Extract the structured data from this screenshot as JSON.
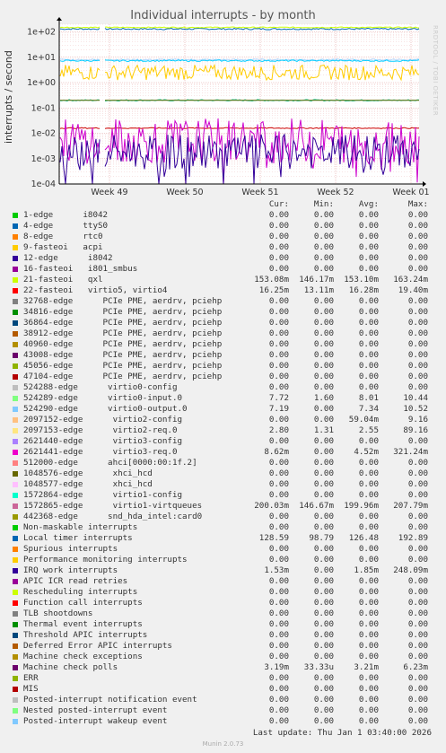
{
  "title": "Individual interrupts - by month",
  "side_credit": "RRDTOOL / TOBI OETIKER",
  "footer": {
    "last_update": "Last update: Thu Jan  1 03:40:00 2026",
    "version": "Munin 2.0.73"
  },
  "columns": [
    "Cur:",
    "Min:",
    "Avg:",
    "Max:"
  ],
  "chart_data": {
    "type": "line",
    "title": "Individual interrupts - by month",
    "ylabel": "interrupts / second",
    "yscale": "log",
    "ylim": [
      0.0001,
      200
    ],
    "y_ticks": [
      "1e-04",
      "1e-03",
      "1e-02",
      "1e-01",
      "1e+00",
      "1e+01",
      "1e+02"
    ],
    "x_ticks": [
      "Week 49",
      "Week 50",
      "Week 51",
      "Week 52",
      "Week 01"
    ],
    "grid": true,
    "series_traces": [
      {
        "name": "Local timer interrupts",
        "color": "#0066b3",
        "level": 130,
        "noise": 0.03
      },
      {
        "name": "1572865-edge",
        "color": "#00cc99",
        "level": 0.2,
        "noise": 0.03
      },
      {
        "name": "21-fasteoi",
        "color": "#ccff00",
        "level": 150,
        "noise": 0.02
      },
      {
        "name": "524289-edge",
        "color": "#b3d9ff",
        "level": 8,
        "noise": 0.03
      },
      {
        "name": "524290-edge",
        "color": "#00ccff",
        "level": 7.3,
        "noise": 0.03
      },
      {
        "name": "2097153-edge",
        "color": "#ffcc00",
        "level": 2.5,
        "noise": 0.3
      },
      {
        "name": "22-fasteoi",
        "color": "#cc0000",
        "level": 0.016,
        "noise": 0.02
      },
      {
        "name": "2621441-edge",
        "color": "#cc00cc",
        "level": 0.005,
        "noise": 0.9
      },
      {
        "name": "IRQ work interrupts",
        "color": "#330099",
        "level": 0.0018,
        "noise": 0.7
      },
      {
        "name": "Machine check polls",
        "color": "#666600",
        "level": 0.2,
        "noise": 0.0
      }
    ]
  },
  "legend": [
    {
      "color": "#00cc00",
      "name": "1-edge      i8042",
      "cur": "0.00",
      "min": "0.00",
      "avg": "0.00",
      "max": "0.00"
    },
    {
      "color": "#0066b3",
      "name": "4-edge      ttyS0",
      "cur": "0.00",
      "min": "0.00",
      "avg": "0.00",
      "max": "0.00"
    },
    {
      "color": "#ff8000",
      "name": "8-edge      rtc0",
      "cur": "0.00",
      "min": "0.00",
      "avg": "0.00",
      "max": "0.00"
    },
    {
      "color": "#ffcc00",
      "name": "9-fasteoi   acpi",
      "cur": "0.00",
      "min": "0.00",
      "avg": "0.00",
      "max": "0.00"
    },
    {
      "color": "#330099",
      "name": "12-edge      i8042",
      "cur": "0.00",
      "min": "0.00",
      "avg": "0.00",
      "max": "0.00"
    },
    {
      "color": "#990099",
      "name": "16-fasteoi   i801_smbus",
      "cur": "0.00",
      "min": "0.00",
      "avg": "0.00",
      "max": "0.00"
    },
    {
      "color": "#ccff00",
      "name": "21-fasteoi   qxl",
      "cur": "153.08m",
      "min": "146.17m",
      "avg": "153.10m",
      "max": "163.24m"
    },
    {
      "color": "#ff0000",
      "name": "22-fasteoi   virtio5, virtio4",
      "cur": "16.25m",
      "min": "13.11m",
      "avg": "16.28m",
      "max": "19.40m"
    },
    {
      "color": "#808080",
      "name": "32768-edge      PCIe PME, aerdrv, pciehp",
      "cur": "0.00",
      "min": "0.00",
      "avg": "0.00",
      "max": "0.00"
    },
    {
      "color": "#008f00",
      "name": "34816-edge      PCIe PME, aerdrv, pciehp",
      "cur": "0.00",
      "min": "0.00",
      "avg": "0.00",
      "max": "0.00"
    },
    {
      "color": "#00487d",
      "name": "36864-edge      PCIe PME, aerdrv, pciehp",
      "cur": "0.00",
      "min": "0.00",
      "avg": "0.00",
      "max": "0.00"
    },
    {
      "color": "#b35a00",
      "name": "38912-edge      PCIe PME, aerdrv, pciehp",
      "cur": "0.00",
      "min": "0.00",
      "avg": "0.00",
      "max": "0.00"
    },
    {
      "color": "#b38f00",
      "name": "40960-edge      PCIe PME, aerdrv, pciehp",
      "cur": "0.00",
      "min": "0.00",
      "avg": "0.00",
      "max": "0.00"
    },
    {
      "color": "#6b006b",
      "name": "43008-edge      PCIe PME, aerdrv, pciehp",
      "cur": "0.00",
      "min": "0.00",
      "avg": "0.00",
      "max": "0.00"
    },
    {
      "color": "#8fb300",
      "name": "45056-edge      PCIe PME, aerdrv, pciehp",
      "cur": "0.00",
      "min": "0.00",
      "avg": "0.00",
      "max": "0.00"
    },
    {
      "color": "#b30000",
      "name": "47104-edge      PCIe PME, aerdrv, pciehp",
      "cur": "0.00",
      "min": "0.00",
      "avg": "0.00",
      "max": "0.00"
    },
    {
      "color": "#bebebe",
      "name": "524288-edge      virtio0-config",
      "cur": "0.00",
      "min": "0.00",
      "avg": "0.00",
      "max": "0.00"
    },
    {
      "color": "#80ff80",
      "name": "524289-edge      virtio0-input.0",
      "cur": "7.72",
      "min": "1.60",
      "avg": "8.01",
      "max": "10.44"
    },
    {
      "color": "#80c9ff",
      "name": "524290-edge      virtio0-output.0",
      "cur": "7.19",
      "min": "0.00",
      "avg": "7.34",
      "max": "10.52"
    },
    {
      "color": "#ffc080",
      "name": "2097152-edge      virtio2-config",
      "cur": "0.00",
      "min": "0.00",
      "avg": "59.04m",
      "max": "9.16"
    },
    {
      "color": "#ffe680",
      "name": "2097153-edge      virtio2-req.0",
      "cur": "2.80",
      "min": "1.31",
      "avg": "2.55",
      "max": "89.16"
    },
    {
      "color": "#aa80ff",
      "name": "2621440-edge      virtio3-config",
      "cur": "0.00",
      "min": "0.00",
      "avg": "0.00",
      "max": "0.00"
    },
    {
      "color": "#ee00cc",
      "name": "2621441-edge      virtio3-req.0",
      "cur": "8.62m",
      "min": "0.00",
      "avg": "4.52m",
      "max": "321.24m"
    },
    {
      "color": "#ff8080",
      "name": "512000-edge      ahci[0000:00:1f.2]",
      "cur": "0.00",
      "min": "0.00",
      "avg": "0.00",
      "max": "0.00"
    },
    {
      "color": "#666600",
      "name": "1048576-edge      xhci_hcd",
      "cur": "0.00",
      "min": "0.00",
      "avg": "0.00",
      "max": "0.00"
    },
    {
      "color": "#ffbfff",
      "name": "1048577-edge      xhci_hcd",
      "cur": "0.00",
      "min": "0.00",
      "avg": "0.00",
      "max": "0.00"
    },
    {
      "color": "#00ffcc",
      "name": "1572864-edge      virtio1-config",
      "cur": "0.00",
      "min": "0.00",
      "avg": "0.00",
      "max": "0.00"
    },
    {
      "color": "#cc6699",
      "name": "1572865-edge      virtio1-virtqueues",
      "cur": "200.03m",
      "min": "146.67m",
      "avg": "199.96m",
      "max": "207.79m"
    },
    {
      "color": "#999900",
      "name": "442368-edge      snd_hda_intel:card0",
      "cur": "0.00",
      "min": "0.00",
      "avg": "0.00",
      "max": "0.00"
    },
    {
      "color": "#00cc00",
      "name": "Non-maskable interrupts",
      "cur": "0.00",
      "min": "0.00",
      "avg": "0.00",
      "max": "0.00"
    },
    {
      "color": "#0066b3",
      "name": "Local timer interrupts",
      "cur": "128.59",
      "min": "98.79",
      "avg": "126.48",
      "max": "192.89"
    },
    {
      "color": "#ff8000",
      "name": "Spurious interrupts",
      "cur": "0.00",
      "min": "0.00",
      "avg": "0.00",
      "max": "0.00"
    },
    {
      "color": "#ffcc00",
      "name": "Performance monitoring interrupts",
      "cur": "0.00",
      "min": "0.00",
      "avg": "0.00",
      "max": "0.00"
    },
    {
      "color": "#330099",
      "name": "IRQ work interrupts",
      "cur": "1.53m",
      "min": "0.00",
      "avg": "1.85m",
      "max": "248.09m"
    },
    {
      "color": "#990099",
      "name": "APIC ICR read retries",
      "cur": "0.00",
      "min": "0.00",
      "avg": "0.00",
      "max": "0.00"
    },
    {
      "color": "#ccff00",
      "name": "Rescheduling interrupts",
      "cur": "0.00",
      "min": "0.00",
      "avg": "0.00",
      "max": "0.00"
    },
    {
      "color": "#ff0000",
      "name": "Function call interrupts",
      "cur": "0.00",
      "min": "0.00",
      "avg": "0.00",
      "max": "0.00"
    },
    {
      "color": "#808080",
      "name": "TLB shootdowns",
      "cur": "0.00",
      "min": "0.00",
      "avg": "0.00",
      "max": "0.00"
    },
    {
      "color": "#008f00",
      "name": "Thermal event interrupts",
      "cur": "0.00",
      "min": "0.00",
      "avg": "0.00",
      "max": "0.00"
    },
    {
      "color": "#00487d",
      "name": "Threshold APIC interrupts",
      "cur": "0.00",
      "min": "0.00",
      "avg": "0.00",
      "max": "0.00"
    },
    {
      "color": "#b35a00",
      "name": "Deferred Error APIC interrupts",
      "cur": "0.00",
      "min": "0.00",
      "avg": "0.00",
      "max": "0.00"
    },
    {
      "color": "#b38f00",
      "name": "Machine check exceptions",
      "cur": "0.00",
      "min": "0.00",
      "avg": "0.00",
      "max": "0.00"
    },
    {
      "color": "#6b006b",
      "name": "Machine check polls",
      "cur": "3.19m",
      "min": "33.33u",
      "avg": "3.21m",
      "max": "6.23m"
    },
    {
      "color": "#8fb300",
      "name": "ERR",
      "cur": "0.00",
      "min": "0.00",
      "avg": "0.00",
      "max": "0.00"
    },
    {
      "color": "#b30000",
      "name": "MIS",
      "cur": "0.00",
      "min": "0.00",
      "avg": "0.00",
      "max": "0.00"
    },
    {
      "color": "#bebebe",
      "name": "Posted-interrupt notification event",
      "cur": "0.00",
      "min": "0.00",
      "avg": "0.00",
      "max": "0.00"
    },
    {
      "color": "#80ff80",
      "name": "Nested posted-interrupt event",
      "cur": "0.00",
      "min": "0.00",
      "avg": "0.00",
      "max": "0.00"
    },
    {
      "color": "#80c9ff",
      "name": "Posted-interrupt wakeup event",
      "cur": "0.00",
      "min": "0.00",
      "avg": "0.00",
      "max": "0.00"
    }
  ]
}
